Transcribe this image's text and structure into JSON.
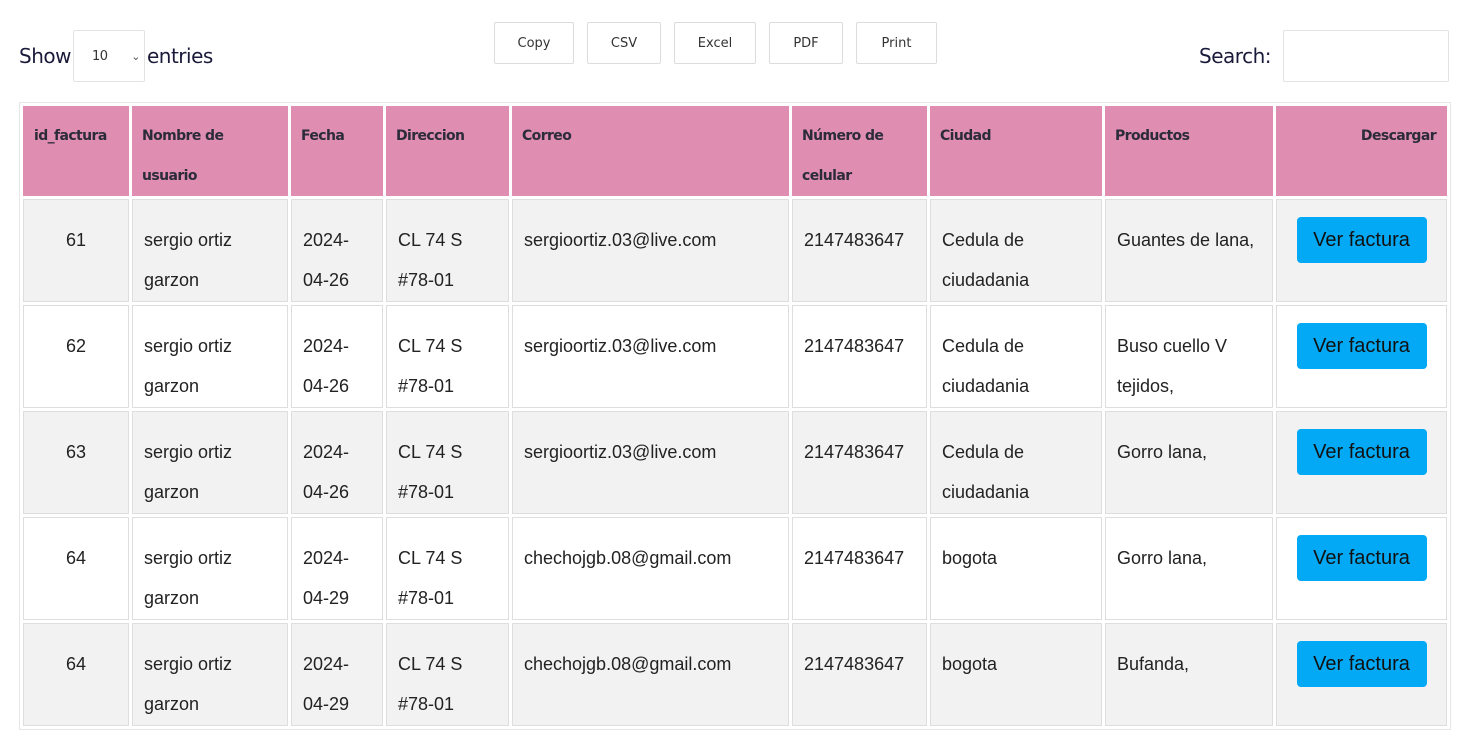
{
  "length_menu": {
    "show_label": "Show",
    "entries_label": "entries",
    "selected": "10"
  },
  "export_buttons": {
    "copy": "Copy",
    "csv": "CSV",
    "excel": "Excel",
    "pdf": "PDF",
    "print": "Print"
  },
  "search": {
    "label": "Search:",
    "value": ""
  },
  "table": {
    "headers": {
      "id": "id_factura",
      "user": "Nombre de usuario",
      "date": "Fecha",
      "address": "Direccion",
      "email": "Correo",
      "phone": "Número de celular",
      "city": "Ciudad",
      "products": "Productos",
      "download": "Descargar"
    },
    "rows": [
      {
        "id": "61",
        "user": "sergio ortiz garzon",
        "date": "2024-04-26",
        "address": "CL 74 S #78-01",
        "email": "sergioortiz.03@live.com",
        "phone": "2147483647",
        "city": "Cedula de ciudadania",
        "products": "Guantes de lana,",
        "action": "Ver factura"
      },
      {
        "id": "62",
        "user": "sergio ortiz garzon",
        "date": "2024-04-26",
        "address": "CL 74 S #78-01",
        "email": "sergioortiz.03@live.com",
        "phone": "2147483647",
        "city": "Cedula de ciudadania",
        "products": "Buso cuello V tejidos,",
        "action": "Ver factura"
      },
      {
        "id": "63",
        "user": "sergio ortiz garzon",
        "date": "2024-04-26",
        "address": "CL 74 S #78-01",
        "email": "sergioortiz.03@live.com",
        "phone": "2147483647",
        "city": "Cedula de ciudadania",
        "products": "Gorro lana,",
        "action": "Ver factura"
      },
      {
        "id": "64",
        "user": "sergio ortiz garzon",
        "date": "2024-04-29",
        "address": "CL 74 S #78-01",
        "email": "chechojgb.08@gmail.com",
        "phone": "2147483647",
        "city": "bogota",
        "products": "Gorro lana,",
        "action": "Ver factura"
      },
      {
        "id": "64",
        "user": "sergio ortiz garzon",
        "date": "2024-04-29",
        "address": "CL 74 S #78-01",
        "email": "chechojgb.08@gmail.com",
        "phone": "2147483647",
        "city": "bogota",
        "products": "Bufanda,",
        "action": "Ver factura"
      }
    ]
  },
  "colors": {
    "header_bg": "#df8db0",
    "button_bg": "#03a9f4",
    "stripe_bg": "#f2f2f2"
  }
}
